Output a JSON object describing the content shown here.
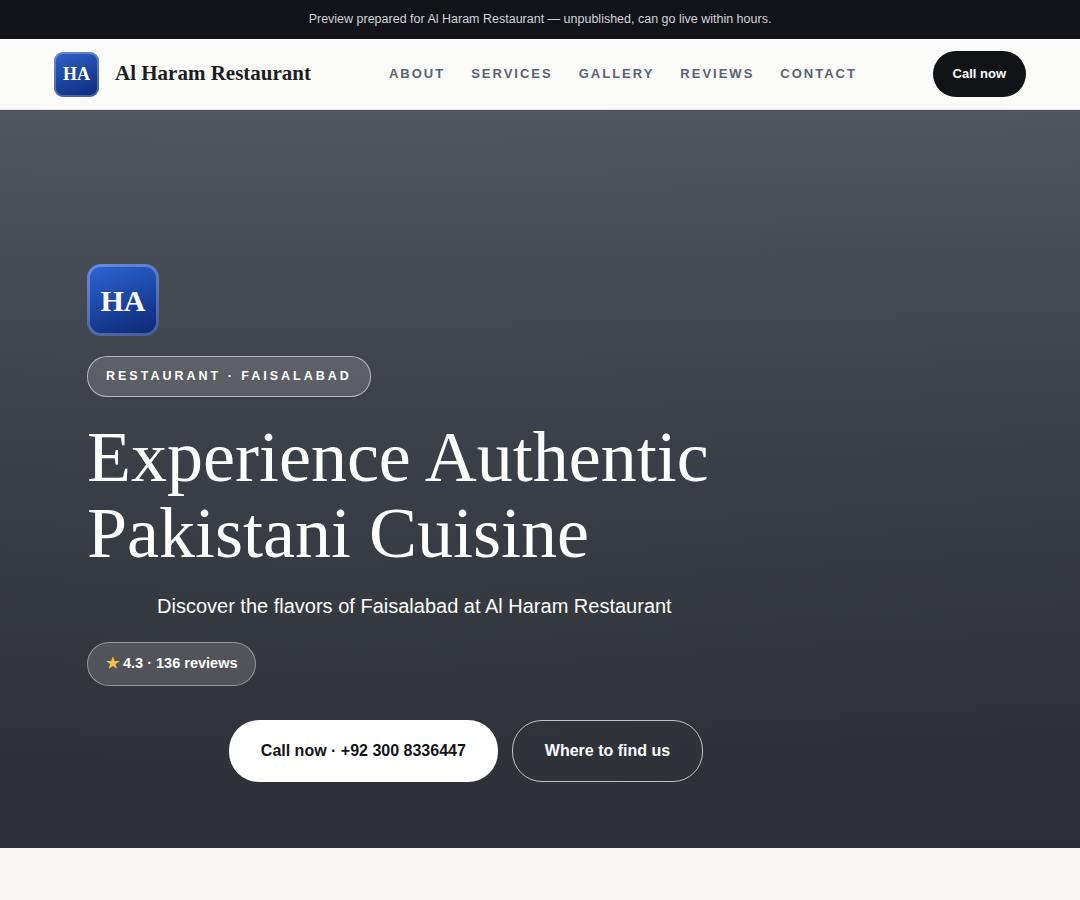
{
  "banner": "Preview prepared for Al Haram Restaurant — unpublished, can go live within hours.",
  "brand": {
    "initials": "HA",
    "name": "Al Haram Restaurant"
  },
  "nav": [
    "ABOUT",
    "SERVICES",
    "GALLERY",
    "REVIEWS",
    "CONTACT"
  ],
  "header_button": "Call now",
  "hero": {
    "logo": "HA",
    "eyebrow": "RESTAURANT · FAISALABAD",
    "title_lines": [
      "Experience Authentic",
      "Pakistani Cuisine"
    ],
    "subtitle": "Discover the flavors of Faisalabad at Al Haram Restaurant",
    "rating": {
      "star": "★",
      "text": "4.3 · 136 reviews"
    },
    "buttons": [
      "Call now · +92 300 8336447",
      "Where to find us"
    ]
  }
}
